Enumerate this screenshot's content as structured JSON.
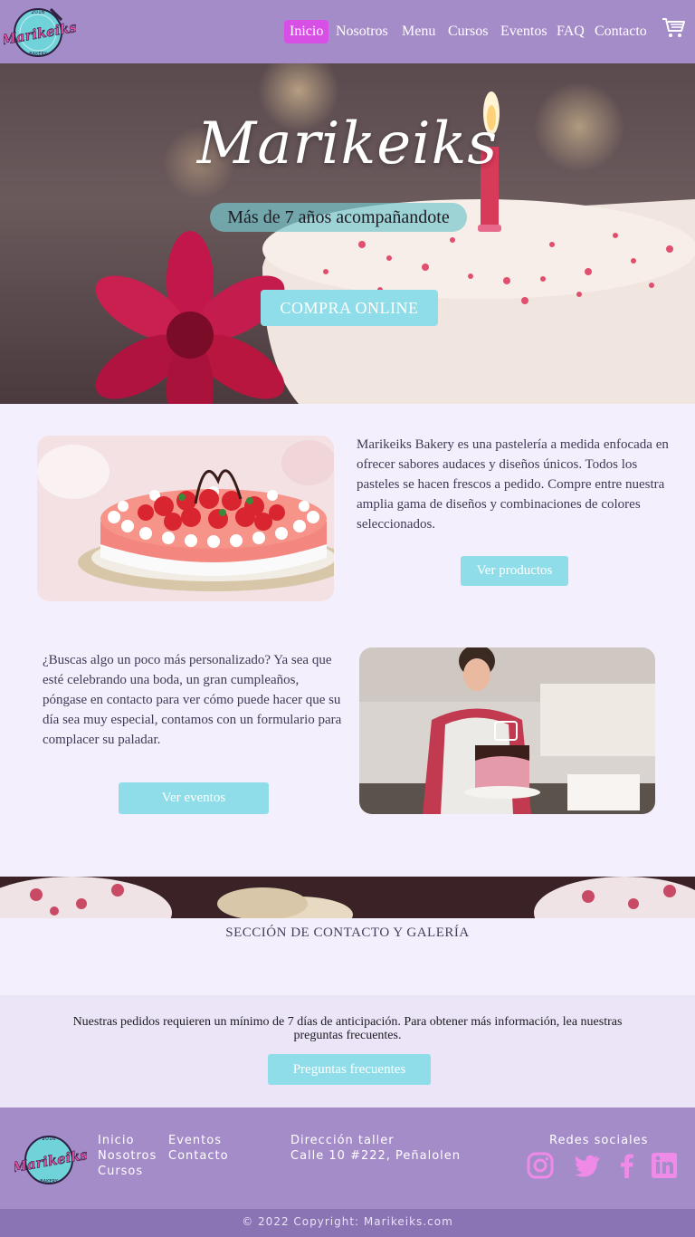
{
  "brand": {
    "name": "Marikeiks",
    "logo_lines": [
      "2016",
      "Marikeiks",
      "BAKERY"
    ]
  },
  "nav": {
    "links": [
      "Inicio",
      "Nosotros",
      "Menu",
      "Cursos",
      "Eventos",
      "FAQ",
      "Contacto"
    ],
    "active": "Inicio",
    "cart_icon": "shopping-cart-icon"
  },
  "hero": {
    "title": "Marikeiks",
    "subtitle": "Más de 7 años acompañandote",
    "cta": "COMPRA ONLINE"
  },
  "intro": {
    "text": "Marikeiks Bakery es una pastelería a medida enfocada en ofrecer sabores audaces y diseños únicos. Todos los pasteles se hacen frescos a pedido. Compre entre nuestra amplia gama de diseños y combinaciones de colores seleccionados.",
    "button": "Ver productos"
  },
  "events": {
    "text": "¿Buscas algo un poco más personalizado? Ya sea que esté celebrando una boda, un gran cumpleaños, póngase en contacto para ver cómo puede hacer que su día sea muy especial, contamos con un formulario para complacer su paladar.",
    "button": "Ver eventos"
  },
  "gallery": {
    "title": "SECCIÓN DE CONTACTO Y GALERÍA"
  },
  "notice": {
    "text": "Nuestras pedidos requieren un mínimo de 7 días de anticipación. Para obtener más información, lea nuestras preguntas frecuentes.",
    "button": "Preguntas frecuentes"
  },
  "footer": {
    "links_col1": [
      "Inicio",
      "Nosotros",
      "Cursos"
    ],
    "links_col2": [
      "Eventos",
      "Contacto"
    ],
    "address_label": "Dirección taller",
    "address": "Calle 10 #222, Peñalolen",
    "social_label": "Redes sociales",
    "social_icons": [
      "instagram-icon",
      "twitter-icon",
      "facebook-icon",
      "linkedin-icon"
    ],
    "copyright": "© 2022 Copyright: Marikeiks.com"
  },
  "colors": {
    "nav": "#a48cc9",
    "active": "#d84fe6",
    "accent": "#8fdde8",
    "page": "#f4effd",
    "notice": "#ebe5f7",
    "copybar": "#8a74b4"
  }
}
